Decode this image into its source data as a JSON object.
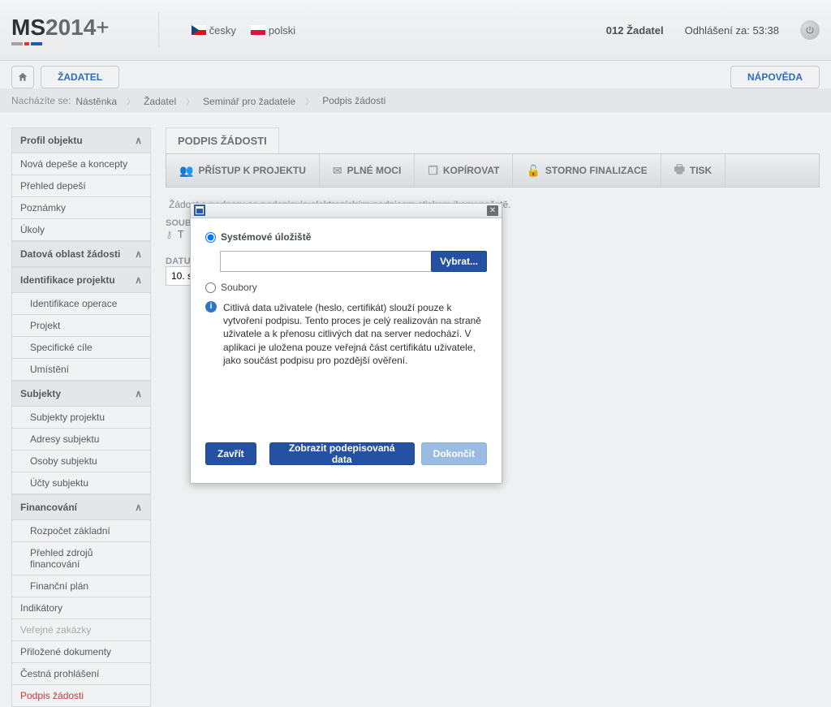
{
  "header": {
    "lang_cz": "česky",
    "lang_pl": "polski",
    "user": "012 Žadatel",
    "logout_prefix": "Odhlášení za:",
    "logout_time": "53:38"
  },
  "topnav": {
    "zadatel": "ŽADATEL",
    "help": "NÁPOVĚDA"
  },
  "crumbs": {
    "label": "Nacházíte se:",
    "c1": "Nástěnka",
    "c2": "Žadatel",
    "c3": "Seminář pro žadatele",
    "c4": "Podpis žádosti"
  },
  "sidebar": {
    "g1": "Profil objektu",
    "i1": "Nová depeše a koncepty",
    "i2": "Přehled depeší",
    "i3": "Poznámky",
    "i4": "Úkoly",
    "g2": "Datová oblast žádosti",
    "g3": "Identifikace projektu",
    "i5": "Identifikace operace",
    "i6": "Projekt",
    "i7": "Specifické cíle",
    "i8": "Umístění",
    "g4": "Subjekty",
    "i9": "Subjekty projektu",
    "i10": "Adresy subjektu",
    "i11": "Osoby subjektu",
    "i12": "Účty subjektu",
    "g5": "Financování",
    "i13": "Rozpočet základní",
    "i14": "Přehled zdrojů financování",
    "i15": "Finanční plán",
    "i16": "Indikátory",
    "i17": "Veřejné zakázky",
    "i18": "Přiložené dokumenty",
    "i19": "Čestná prohlášení",
    "i20": "Podpis žádosti"
  },
  "content": {
    "title": "PODPIS ŽÁDOSTI",
    "tool1": "PŘÍSTUP K PROJEKTU",
    "tool2": "PLNÉ MOCI",
    "tool3": "KOPÍROVAT",
    "tool4": "STORNO FINALIZACE",
    "tool5": "TISK",
    "info": "Žádost o podporu se podepisuje elektronickým podpisem stiskem ikony pečetě.",
    "soubor_label": "SOUBOR",
    "soubor_below": "T",
    "date_label": "DATUM",
    "date_value": "10. s"
  },
  "modal": {
    "opt1": "Systémové úložiště",
    "opt2": "Soubory",
    "choose": "Vybrat...",
    "info": "Citlivá data uživatele (heslo, certifikát) slouží pouze k vytvoření podpisu. Tento proces je celý realizován na straně uživatele a k přenosu citlivých dat na server nedochází. V aplikaci je uložena pouze veřejná část certifikátu uživatele, jako součást podpisu pro pozdější ověření.",
    "close": "Zavřít",
    "show": "Zobrazit podepisovaná data",
    "finish": "Dokončit"
  }
}
